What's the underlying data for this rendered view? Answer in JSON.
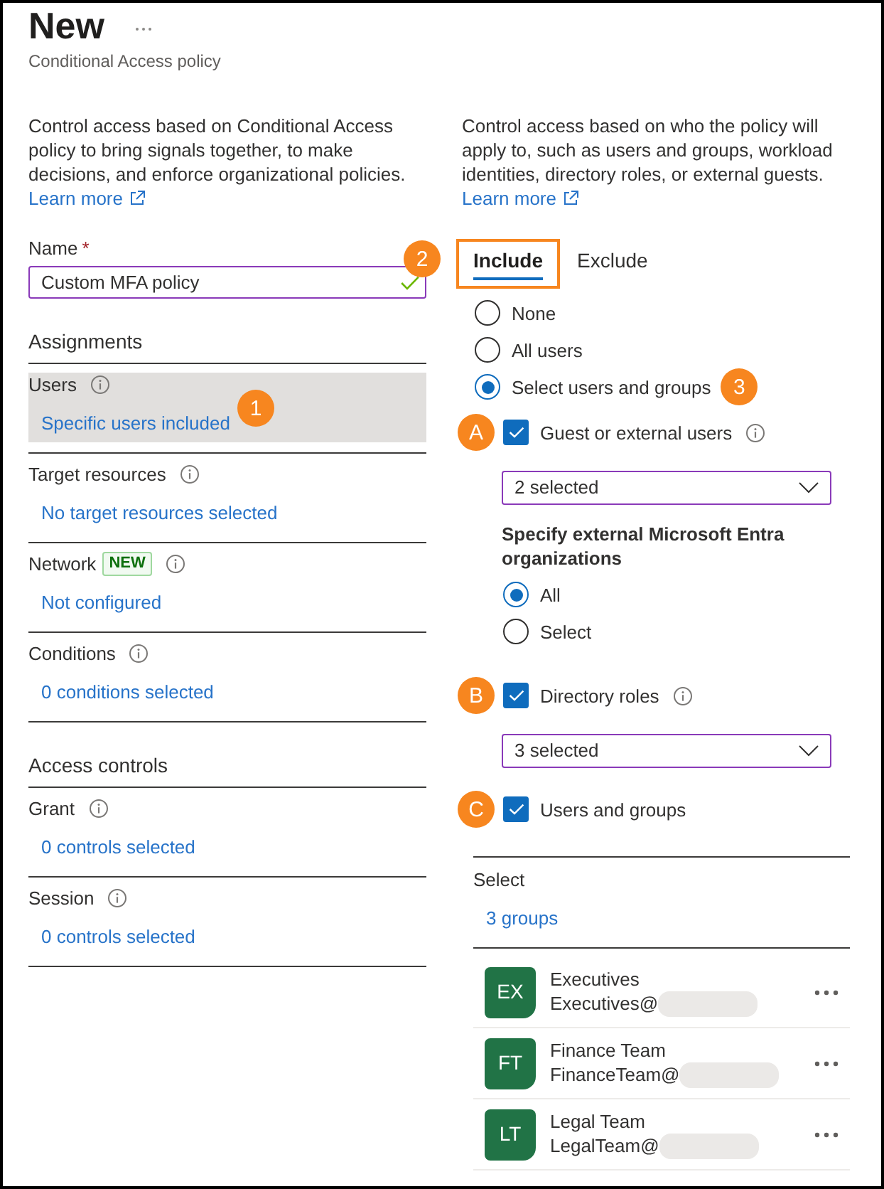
{
  "header": {
    "title": "New",
    "subtitle": "Conditional Access policy"
  },
  "policy": {
    "description": "Control access based on Conditional Access policy to bring signals together, to make decisions, and enforce organizational policies.",
    "learn_more": "Learn more",
    "name_field": {
      "label": "Name",
      "required_mark": "*",
      "value": "Custom MFA policy",
      "valid": true
    },
    "sections": [
      {
        "heading": "Assignments",
        "items": [
          {
            "label": "Users",
            "info": true,
            "value": "Specific users included",
            "selected": true,
            "callout": "1"
          },
          {
            "label": "Target resources",
            "info": true,
            "value": "No target resources selected",
            "selected": false
          },
          {
            "label": "Network",
            "badge": "NEW",
            "info": true,
            "value": "Not configured",
            "selected": false
          },
          {
            "label": "Conditions",
            "info": true,
            "value": "0 conditions selected",
            "selected": false
          }
        ]
      },
      {
        "heading": "Access controls",
        "items": [
          {
            "label": "Grant",
            "info": true,
            "value": "0 controls selected",
            "selected": false
          },
          {
            "label": "Session",
            "info": true,
            "value": "0 controls selected",
            "selected": false
          }
        ]
      }
    ]
  },
  "users": {
    "description": "Control access based on who the policy will apply to, such as users and groups, workload identities, directory roles, or external guests.",
    "learn_more": "Learn more",
    "tabs_callout": "2",
    "tabs": [
      {
        "label": "Include",
        "selected": true,
        "highlighted": true
      },
      {
        "label": "Exclude",
        "selected": false,
        "highlighted": false
      }
    ],
    "scope_options": [
      {
        "label": "None",
        "selected": false
      },
      {
        "label": "All users",
        "selected": false
      },
      {
        "label": "Select users and groups",
        "selected": true,
        "callout": "3"
      }
    ],
    "include_types": [
      {
        "label": "Guest or external users",
        "checked": true,
        "info": true,
        "callout": "A",
        "dropdown": "2 selected",
        "organizations": {
          "heading": "Specify external Microsoft Entra organizations",
          "options": [
            {
              "label": "All",
              "selected": true
            },
            {
              "label": "Select",
              "selected": false
            }
          ]
        }
      },
      {
        "label": "Directory roles",
        "checked": true,
        "info": true,
        "callout": "B",
        "dropdown": "3 selected"
      },
      {
        "label": "Users and groups",
        "checked": true,
        "info": false,
        "callout": "C"
      }
    ],
    "selection": {
      "label": "Select",
      "value": "3 groups",
      "groups": [
        {
          "initials": "EX",
          "name": "Executives",
          "email": "Executives@"
        },
        {
          "initials": "FT",
          "name": "Finance Team",
          "email": "FinanceTeam@"
        },
        {
          "initials": "LT",
          "name": "Legal Team",
          "email": "LegalTeam@"
        }
      ]
    }
  }
}
